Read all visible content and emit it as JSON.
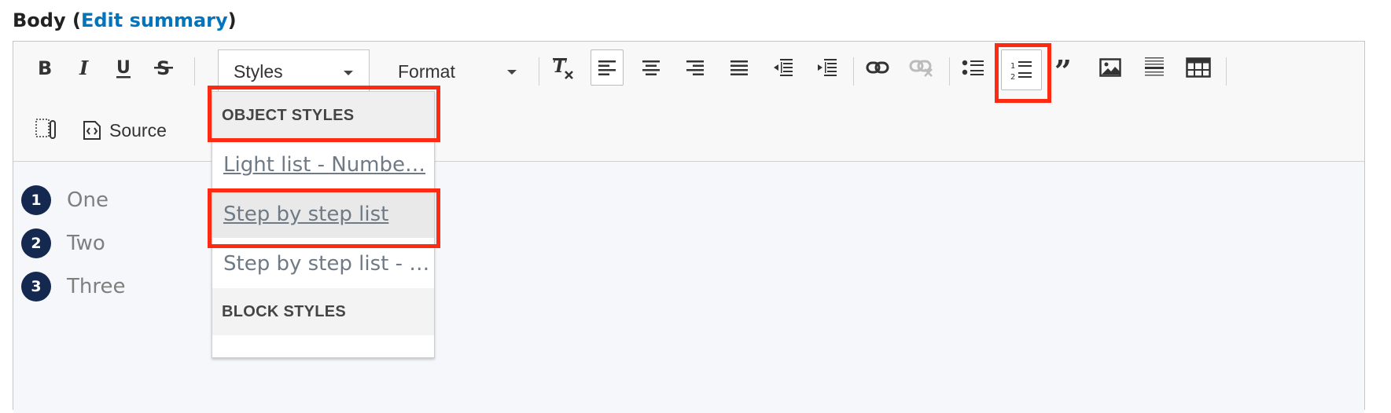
{
  "field": {
    "label_prefix": "Body (",
    "link": "Edit summary",
    "label_suffix": ")"
  },
  "toolbar": {
    "styles_label": "Styles",
    "format_label": "Format",
    "source_label": "Source",
    "buttons": [
      "bold-icon",
      "italic-icon",
      "underline-icon",
      "strikethrough-icon",
      "remove-format-icon",
      "align-left-icon",
      "align-center-icon",
      "align-right-icon",
      "justify-icon",
      "outdent-icon",
      "indent-icon",
      "link-icon",
      "unlink-icon",
      "bulleted-list-icon",
      "numbered-list-icon",
      "blockquote-icon",
      "image-icon",
      "horizontal-rule-icon",
      "table-icon",
      "show-blocks-icon",
      "source-icon"
    ]
  },
  "dropdown": {
    "object_styles_header": "OBJECT STYLES",
    "items": [
      "Light list - Numbe…",
      "Step by step list",
      "Step by step list - …"
    ],
    "block_styles_header": "BLOCK STYLES"
  },
  "content": {
    "steps": [
      {
        "num": "1",
        "text": "One"
      },
      {
        "num": "2",
        "text": "Two"
      },
      {
        "num": "3",
        "text": "Three"
      }
    ]
  },
  "colors": {
    "link": "#0074bd",
    "highlight": "#ff2a12",
    "step_badge": "#142850"
  }
}
